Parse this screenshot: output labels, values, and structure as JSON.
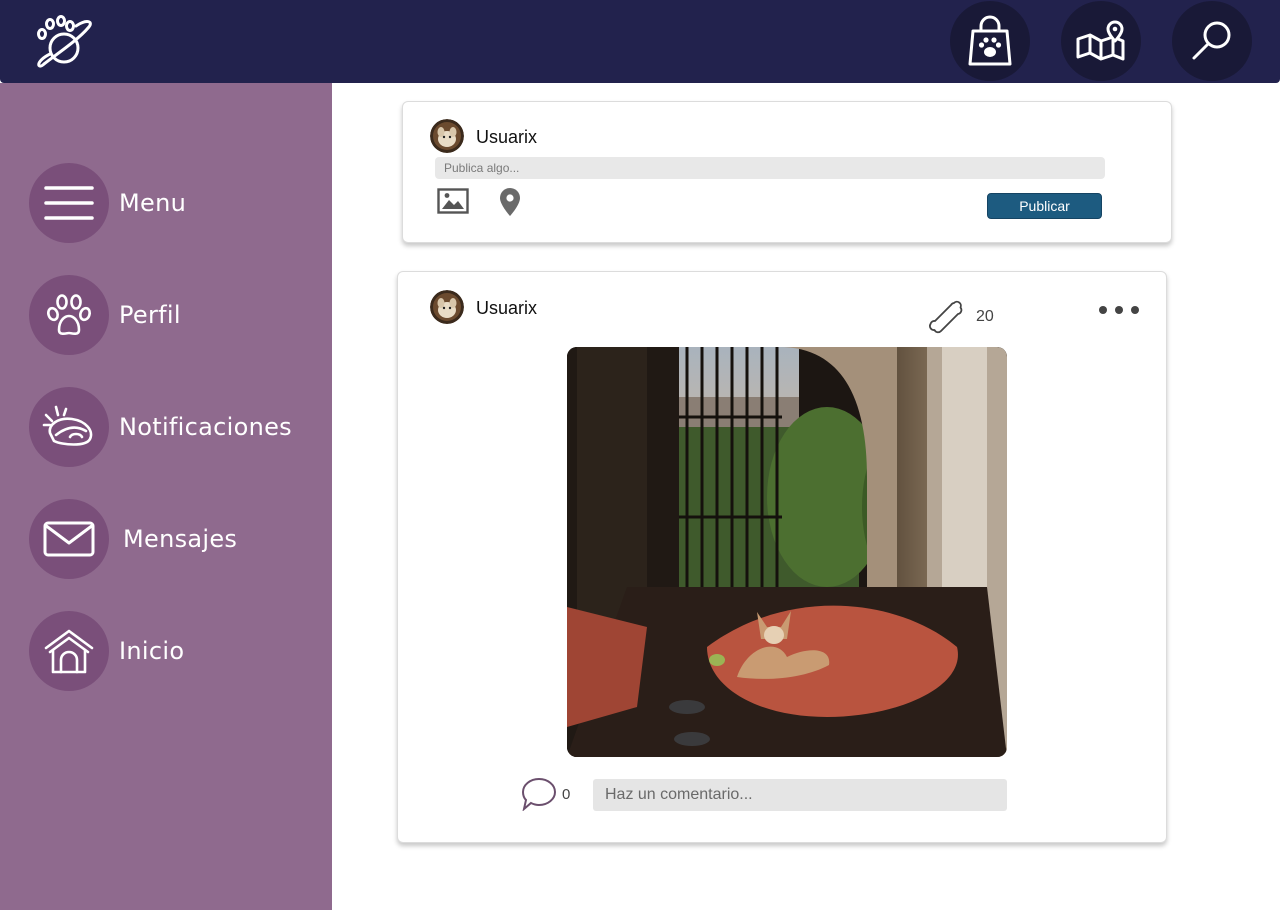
{
  "colors": {
    "topbar": "#22224d",
    "topbar_button": "#191937",
    "sidebar": "#8f6a8e",
    "sidebar_circle": "#7a4f7a",
    "publish_button": "#1d5b80"
  },
  "topbar": {
    "logo_icon": "planet-paw-icon",
    "buttons": [
      {
        "icon": "shopping-bag-paw-icon"
      },
      {
        "icon": "map-pin-icon"
      },
      {
        "icon": "search-icon"
      }
    ]
  },
  "sidebar": {
    "items": [
      {
        "label": "Menu",
        "icon": "hamburger-menu-icon"
      },
      {
        "label": "Perfil",
        "icon": "paw-icon"
      },
      {
        "label": "Notificaciones",
        "icon": "food-bowl-icon"
      },
      {
        "label": "Mensajes",
        "icon": "envelope-icon"
      },
      {
        "label": "Inicio",
        "icon": "doghouse-icon"
      }
    ]
  },
  "composer": {
    "username": "Usuarix",
    "placeholder": "Publica algo...",
    "photo_icon": "image-icon",
    "location_icon": "location-pin-icon",
    "publish_label": "Publicar"
  },
  "post": {
    "username": "Usuarix",
    "likes_icon": "bone-icon",
    "likes_count": "20",
    "more_icon": "more-dots-icon",
    "image": "dog-on-sunny-patio-photo",
    "comments_icon": "speech-bubble-icon",
    "comments_count": "0",
    "comment_placeholder": "Haz un comentario..."
  }
}
